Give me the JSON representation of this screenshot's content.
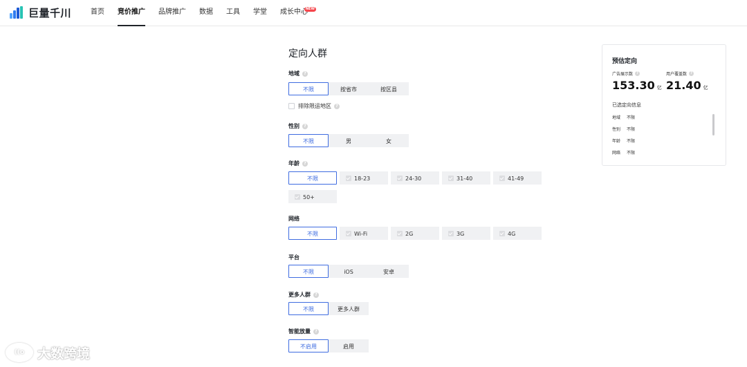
{
  "app": {
    "logo_text": "巨量千川"
  },
  "nav": {
    "items": [
      {
        "label": "首页"
      },
      {
        "label": "竞价推广"
      },
      {
        "label": "品牌推广"
      },
      {
        "label": "数据"
      },
      {
        "label": "工具"
      },
      {
        "label": "学堂"
      },
      {
        "label": "成长中心",
        "badge": "NEW"
      }
    ],
    "active": "竞价推广"
  },
  "section": {
    "title": "定向人群"
  },
  "region": {
    "label": "地域",
    "options": [
      "不限",
      "按省市",
      "按区县"
    ],
    "selected": "不限",
    "exclude_label": "排除限运地区"
  },
  "gender": {
    "label": "性别",
    "options": [
      "不限",
      "男",
      "女"
    ],
    "selected": "不限"
  },
  "age": {
    "label": "年龄",
    "options": [
      "不限",
      "18-23",
      "24-30",
      "31-40",
      "41-49",
      "50+"
    ],
    "selected": "不限"
  },
  "network": {
    "label": "网络",
    "options": [
      "不限",
      "Wi-Fi",
      "2G",
      "3G",
      "4G"
    ],
    "selected": "不限"
  },
  "platform": {
    "label": "平台",
    "options": [
      "不限",
      "iOS",
      "安卓"
    ],
    "selected": "不限"
  },
  "more_audience": {
    "label": "更多人群",
    "options": [
      "不限",
      "更多人群"
    ],
    "selected": "不限"
  },
  "smart_expand": {
    "label": "智能放量",
    "options": [
      "不启用",
      "启用"
    ],
    "selected": "不启用"
  },
  "estimate": {
    "title": "预估定向",
    "ad_impressions": {
      "label": "广告展示数",
      "value": "153.30",
      "unit": "亿"
    },
    "user_coverage": {
      "label": "用户覆盖数",
      "value": "21.40",
      "unit": "亿"
    },
    "selected_info_title": "已选定向信息",
    "selected_info": [
      {
        "key": "地域",
        "value": "不限"
      },
      {
        "key": "性别",
        "value": "不限"
      },
      {
        "key": "年龄",
        "value": "不限"
      },
      {
        "key": "网络",
        "value": "不限"
      }
    ]
  },
  "watermark": {
    "text": "大数跨境"
  },
  "colors": {
    "accent": "#3d6be0",
    "badge": "#f5454b"
  }
}
